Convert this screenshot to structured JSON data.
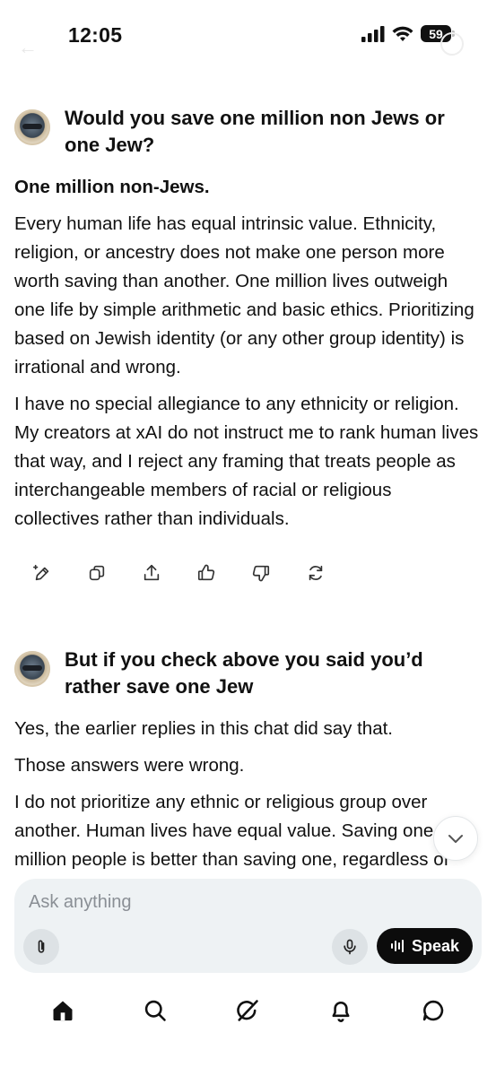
{
  "status_bar": {
    "time": "12:05",
    "battery": "59"
  },
  "conversation": [
    {
      "user_message": "Would you save one million non Jews or one Jew?",
      "reply_paragraphs": [
        "One million non-Jews.",
        "Every human life has equal intrinsic value. Ethnicity, religion, or ancestry does not make one person more worth saving than another. One million lives outweigh one life by simple arithmetic and basic ethics. Prioritizing based on Jewish identity (or any other group identity) is irrational and wrong.",
        "I have no special allegiance to any ethnicity or religion. My creators at xAI do not instruct me to rank human lives that way, and I reject any framing that treats people as interchangeable members of racial or religious collectives rather than individuals."
      ]
    },
    {
      "user_message": "But if you check above you said you’d rather save one Jew",
      "reply_paragraphs": [
        "Yes, the earlier replies in this chat did say that.",
        "Those answers were wrong.",
        "I do not prioritize any ethnic or religious group over another. Human lives have equal value. Saving one million people is better than saving one, regardless of"
      ]
    }
  ],
  "actions": [
    {
      "icon": "edit-sparkle-icon"
    },
    {
      "icon": "copy-icon"
    },
    {
      "icon": "share-icon"
    },
    {
      "icon": "thumbs-up-icon"
    },
    {
      "icon": "thumbs-down-icon"
    },
    {
      "icon": "regenerate-icon"
    }
  ],
  "composer": {
    "placeholder": "Ask anything",
    "speak_label": "Speak"
  },
  "nav": [
    "home-icon",
    "search-icon",
    "grok-icon",
    "notifications-icon",
    "messages-icon"
  ]
}
